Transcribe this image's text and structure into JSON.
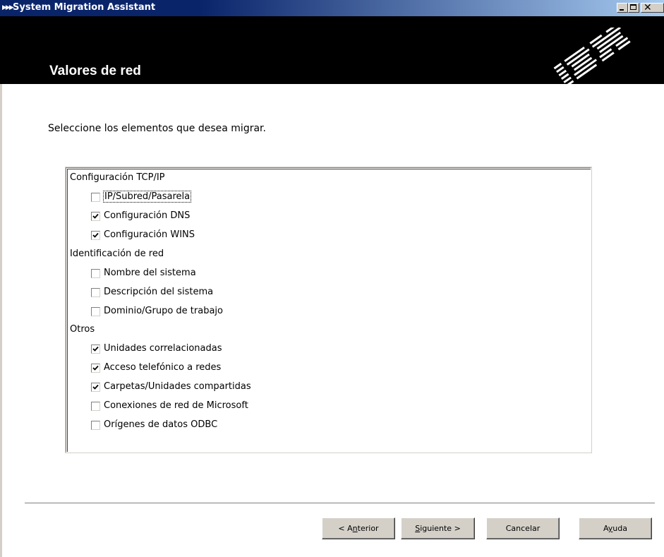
{
  "window": {
    "title": "System Migration Assistant",
    "controls": {
      "minimize": "_",
      "maximize": "□",
      "close": "×"
    }
  },
  "banner": {
    "page_title": "Valores de red",
    "logo": "IBM"
  },
  "instruction": "Seleccione los elementos que desea migrar.",
  "groups": [
    {
      "label": "Configuración TCP/IP",
      "items": [
        {
          "label": "IP/Subred/Pasarela",
          "checked": false,
          "focused": true
        },
        {
          "label": "Configuración DNS",
          "checked": true
        },
        {
          "label": "Configuración WINS",
          "checked": true
        }
      ]
    },
    {
      "label": "Identificación de red",
      "items": [
        {
          "label": "Nombre del sistema",
          "checked": false
        },
        {
          "label": "Descripción del sistema",
          "checked": false
        },
        {
          "label": "Dominio/Grupo de trabajo",
          "checked": false
        }
      ]
    },
    {
      "label": "Otros",
      "items": [
        {
          "label": "Unidades correlacionadas",
          "checked": true
        },
        {
          "label": "Acceso telefónico a redes",
          "checked": true
        },
        {
          "label": "Carpetas/Unidades compartidas",
          "checked": true
        },
        {
          "label": "Conexiones de red de Microsoft",
          "checked": false
        },
        {
          "label": "Orígenes de datos ODBC",
          "checked": false
        }
      ]
    }
  ],
  "buttons": {
    "back": {
      "pre": "< A",
      "mnemonic": "n",
      "post": "terior"
    },
    "next": {
      "pre": "",
      "mnemonic": "S",
      "post": "iguiente >"
    },
    "cancel": {
      "pre": "Cancelar",
      "mnemonic": "",
      "post": ""
    },
    "help": {
      "pre": "A",
      "mnemonic": "y",
      "post": "uda"
    }
  },
  "colors": {
    "titlebar_start": "#0a246a",
    "titlebar_end": "#a6caf0",
    "banner": "#000000",
    "button_face": "#d4d0c8"
  }
}
